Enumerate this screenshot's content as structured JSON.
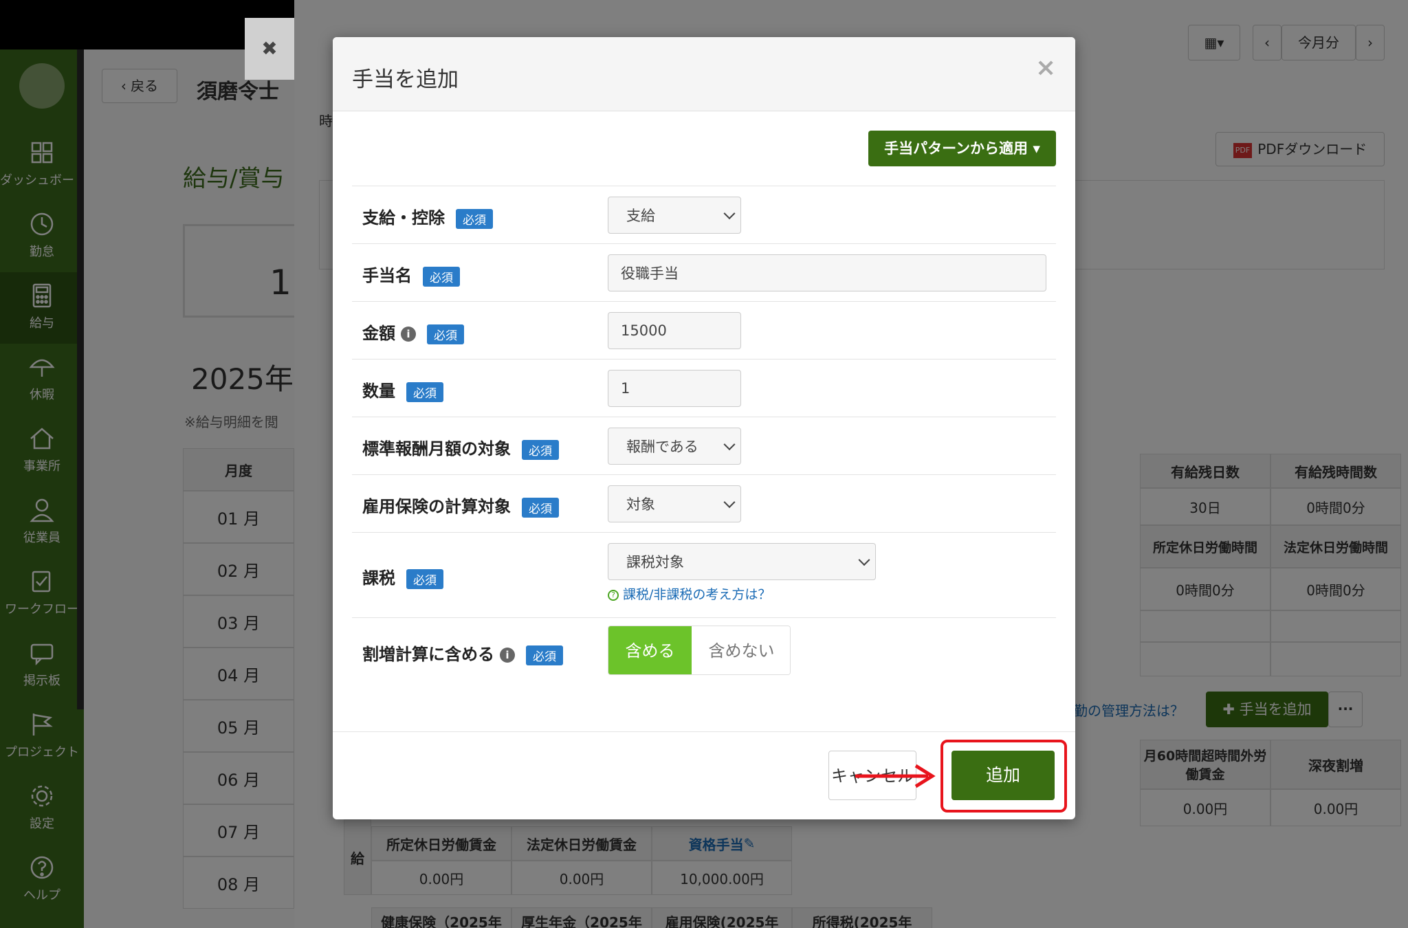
{
  "sidebar": {
    "items": [
      {
        "label": "ダッシュボード",
        "icon": "dashboard-icon"
      },
      {
        "label": "勤怠",
        "icon": "clock-icon"
      },
      {
        "label": "給与",
        "icon": "calculator-icon"
      },
      {
        "label": "休暇",
        "icon": "umbrella-icon"
      },
      {
        "label": "事業所",
        "icon": "home-icon"
      },
      {
        "label": "従業員",
        "icon": "user-icon"
      },
      {
        "label": "ワークフロー",
        "icon": "checklist-icon"
      },
      {
        "label": "掲示板",
        "icon": "chat-icon"
      },
      {
        "label": "プロジェクト",
        "icon": "flag-icon"
      },
      {
        "label": "設定",
        "icon": "gear-icon"
      },
      {
        "label": "ヘルプ",
        "icon": "question-icon"
      }
    ]
  },
  "background": {
    "back_label": "戻る",
    "employee_name": "須磨令士",
    "section_title": "給与/賞与",
    "year_label": "2025年",
    "note": "※給与明細を閲",
    "month_header": "月度",
    "months": [
      "01 月",
      "02 月",
      "03 月",
      "04 月",
      "05 月",
      "06 月",
      "07 月",
      "08 月"
    ],
    "partial_digit": "1",
    "partial_label": "時",
    "this_month": "今月分",
    "pdf_download": "PDFダウンロード",
    "pdf_badge": "PDF",
    "stats": {
      "paid_days_header": "有給残日数",
      "paid_hours_header": "有給残時間数",
      "paid_days": "30日",
      "paid_hours": "0時間0分",
      "scheduled_holiday_header": "所定休日労働時間",
      "legal_holiday_header": "法定休日労働時間",
      "scheduled_holiday": "0時間0分",
      "legal_holiday": "0時間0分"
    },
    "manage_link": "勤の管理方法は？",
    "add_allowance": "手当を追加",
    "more": "···",
    "pay_table": {
      "overtime60_header": "月60時間超時間外労働賃金",
      "night_header": "深夜割増",
      "overtime60": "0.00円",
      "night": "0.00円",
      "row_label": "給",
      "headers": [
        "所定休日労働賃金",
        "法定休日労働賃金",
        "資格手当"
      ],
      "values": [
        "0.00円",
        "0.00円",
        "10,000.00円"
      ],
      "deduction_headers": [
        "健康保険（2025年",
        "厚生年金（2025年",
        "雇用保険(2025年",
        "所得税(2025年"
      ]
    }
  },
  "modal": {
    "title": "手当を追加",
    "close": "×",
    "pattern_button": "手当パターンから適用",
    "required": "必須",
    "fields": {
      "type_label": "支給・控除",
      "type_value": "支給",
      "name_label": "手当名",
      "name_value": "役職手当",
      "amount_label": "金額",
      "amount_value": "15000",
      "qty_label": "数量",
      "qty_value": "1",
      "std_label": "標準報酬月額の対象",
      "std_value": "報酬である",
      "emp_label": "雇用保険の計算対象",
      "emp_value": "対象",
      "tax_label": "課税",
      "tax_value": "課税対象",
      "tax_help": "課税/非課税の考え方は？",
      "premium_label": "割増計算に含める",
      "premium_on": "含める",
      "premium_off": "含めない"
    },
    "cancel": "キャンセル",
    "add": "追加"
  },
  "colors": {
    "sidebar": "#3c6c1c",
    "primary_button": "#3a6e12",
    "toggle_active": "#6cc32a",
    "required_badge": "#2a7cc9",
    "highlight": "#e8141c"
  }
}
